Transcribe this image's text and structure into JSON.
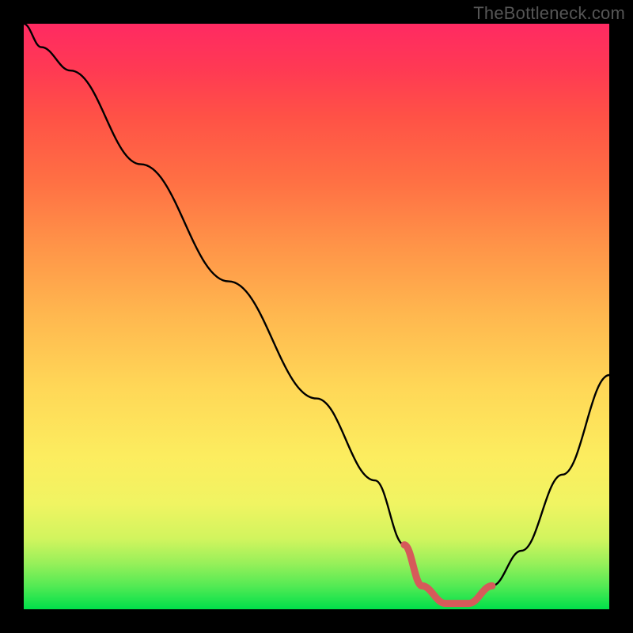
{
  "watermark": "TheBottleneck.com",
  "chart_data": {
    "type": "line",
    "title": "",
    "xlabel": "",
    "ylabel": "",
    "xlim": [
      0,
      100
    ],
    "ylim": [
      0,
      100
    ],
    "series": [
      {
        "name": "curve",
        "x": [
          0,
          3,
          8,
          20,
          35,
          50,
          60,
          65,
          68,
          72,
          76,
          80,
          85,
          92,
          100
        ],
        "values": [
          100,
          96,
          92,
          76,
          56,
          36,
          22,
          11,
          4,
          1,
          1,
          4,
          10,
          23,
          40
        ],
        "color": "#000000"
      },
      {
        "name": "highlight-segment",
        "x": [
          65,
          68,
          72,
          76,
          80
        ],
        "values": [
          11,
          4,
          1,
          1,
          4
        ],
        "color": "#d65a5a"
      }
    ],
    "gradient_stops": [
      {
        "pct": 0,
        "color": "#00e04a"
      },
      {
        "pct": 4,
        "color": "#54ea54"
      },
      {
        "pct": 8,
        "color": "#9af05a"
      },
      {
        "pct": 12,
        "color": "#d1f45e"
      },
      {
        "pct": 18,
        "color": "#f0f462"
      },
      {
        "pct": 26,
        "color": "#fced5f"
      },
      {
        "pct": 38,
        "color": "#ffd757"
      },
      {
        "pct": 50,
        "color": "#ffb84f"
      },
      {
        "pct": 62,
        "color": "#ff9448"
      },
      {
        "pct": 73,
        "color": "#ff7044"
      },
      {
        "pct": 84,
        "color": "#ff5246"
      },
      {
        "pct": 92,
        "color": "#ff3a53"
      },
      {
        "pct": 100,
        "color": "#ff2a62"
      }
    ]
  }
}
